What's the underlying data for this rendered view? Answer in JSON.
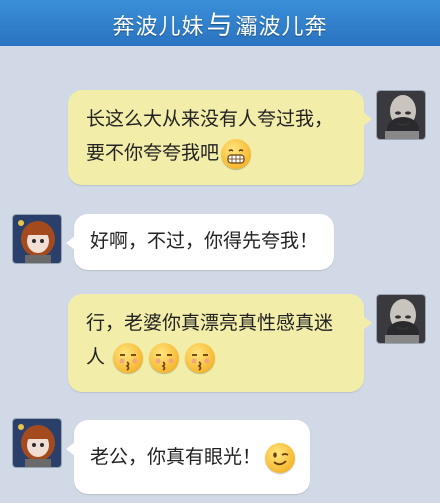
{
  "header": {
    "title_left": "奔波儿妹",
    "title_mid": "与",
    "title_right": "灞波儿奔"
  },
  "messages": [
    {
      "side": "right",
      "lines": [
        "长这么大从来没有人夸过我，",
        "要不你夸夸我吧"
      ],
      "emojis": [
        "grinning-teeth"
      ]
    },
    {
      "side": "left",
      "lines": [
        "好啊，不过，你得先夸我！"
      ],
      "emojis": []
    },
    {
      "side": "right",
      "lines": [
        "行，老婆你真漂亮真性感真迷",
        "人"
      ],
      "emojis": [
        "kissing-face",
        "kissing-face",
        "kissing-face"
      ]
    },
    {
      "side": "left",
      "lines": [
        "老公，你真有眼光！"
      ],
      "emojis": [
        "winking-face"
      ]
    }
  ],
  "colors": {
    "background": "#d1d9e6",
    "header": "#2f7ccb",
    "bubble_right": "#f2eeaa",
    "bubble_left": "#ffffff"
  }
}
